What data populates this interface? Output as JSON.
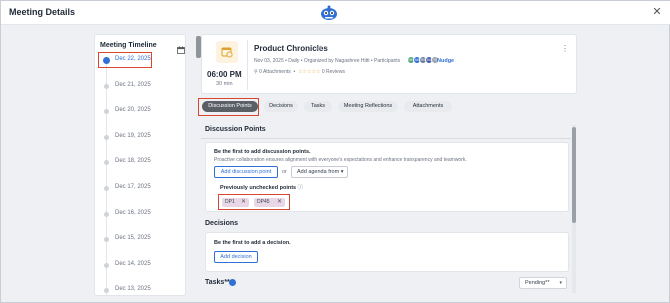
{
  "window": {
    "title": "Meeting Details",
    "close_glyph": "✕"
  },
  "timeline": {
    "title": "Meeting Timeline",
    "dates": [
      "Dec 22, 2025",
      "Dec 21, 2025",
      "Dec 20, 2025",
      "Dec 19, 2025",
      "Dec 18, 2025",
      "Dec 17, 2025",
      "Dec 16, 2025",
      "Dec 15, 2025",
      "Dec 14, 2025",
      "Dec 13, 2025"
    ],
    "active_index": 0
  },
  "meeting": {
    "time": "06:00 PM",
    "duration": "30 min",
    "name": "Product Chronicles",
    "recur_glyph": "⇄",
    "meta": "Nov 03, 2025  •  Daily  •  Organized by Nagashree Hitti  •  Participants",
    "participants": [
      {
        "initials": "NH",
        "color": "#4aa47a"
      },
      {
        "initials": "AK",
        "color": "#2f6fd6"
      },
      {
        "initials": "RS",
        "color": "#6b7b9a"
      },
      {
        "initials": "MJ",
        "color": "#3b5aa8"
      },
      {
        "initials": "+3",
        "color": "#9aa1ab"
      }
    ],
    "nudge": "Nudge",
    "attachments": "0 Attachments",
    "stars": "☆☆☆☆☆",
    "reviews": "0 Reviews",
    "menu_glyph": "⋮"
  },
  "tabs": [
    {
      "label": "Discussion Points",
      "active": true
    },
    {
      "label": "Decisions",
      "active": false
    },
    {
      "label": "Tasks",
      "active": false
    },
    {
      "label": "Meeting Reflections",
      "active": false
    },
    {
      "label": "Attachments",
      "active": false
    }
  ],
  "discussion": {
    "section_title": "Discussion Points",
    "heading": "Be the first to add discussion points.",
    "text": "Proactive collaboration ensures alignment with everyone's expectations and enhance transparency and teamwork.",
    "add_button": "Add discussion point",
    "or": "or",
    "agenda_button": "Add agenda from",
    "agenda_caret": "▾",
    "prev_label": "Previously unchecked points",
    "info_glyph": "ⓘ",
    "chips": [
      "DP1",
      "DP45"
    ],
    "chip_remove": "✕"
  },
  "decisions": {
    "section_title": "Decisions",
    "heading": "Be the first to add a decision.",
    "add_button": "Add decision"
  },
  "tasks": {
    "section_title": "Tasks**",
    "filter_value": "Pending**",
    "filter_caret": "▾"
  },
  "colors": {
    "accent": "#2f6fd6",
    "highlight": "#d9462e",
    "chip": "#e9d7e7"
  }
}
